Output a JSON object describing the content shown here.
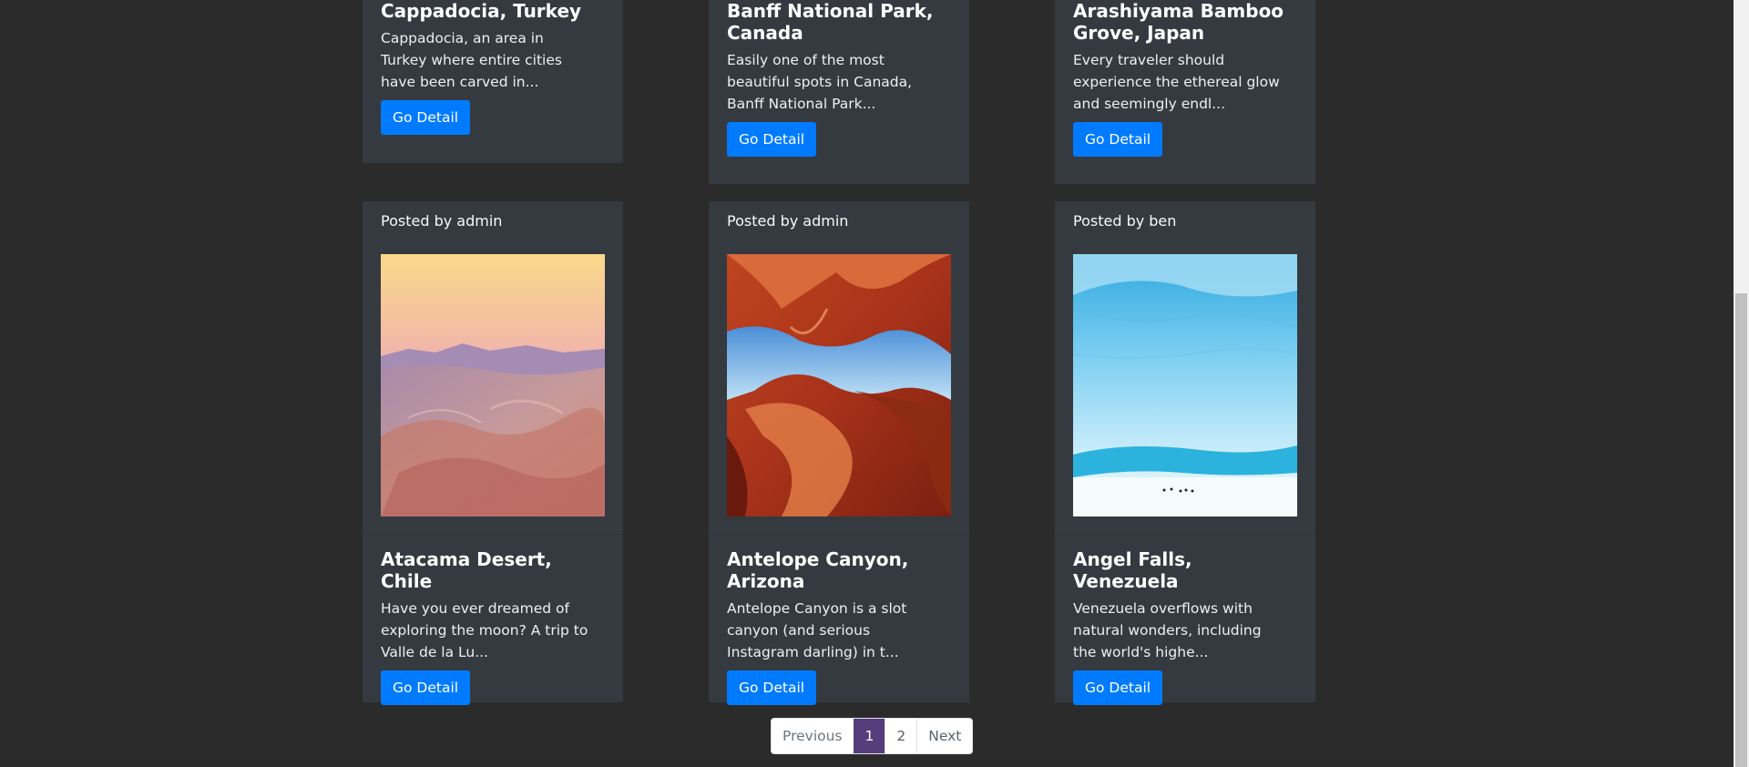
{
  "top_cards": [
    {
      "title": "Cappadocia, Turkey",
      "text": "Cappadocia, an area in Turkey where entire cities have been carved in...",
      "button": "Go Detail"
    },
    {
      "title": "Banff National Park, Canada",
      "text": "Easily one of the most beautiful spots in Canada, Banff National Park...",
      "button": "Go Detail"
    },
    {
      "title": "Arashiyama Bamboo Grove, Japan",
      "text": "Every traveler should experience the ethereal glow and seemingly endl...",
      "button": "Go Detail"
    }
  ],
  "cards": [
    {
      "posted_by": "Posted by admin",
      "image_icon": "desert-landscape-image",
      "title": "Atacama Desert, Chile",
      "text": "Have you ever dreamed of exploring the moon? A trip to Valle de la Lu...",
      "button": "Go Detail"
    },
    {
      "posted_by": "Posted by admin",
      "image_icon": "slot-canyon-image",
      "title": "Antelope Canyon, Arizona",
      "text": "Antelope Canyon is a slot canyon (and serious Instagram darling) in t...",
      "button": "Go Detail"
    },
    {
      "posted_by": "Posted by ben",
      "image_icon": "glacier-image",
      "title": "Angel Falls, Venezuela",
      "text": "Venezuela overflows with natural wonders, including the world's highe...",
      "button": "Go Detail"
    }
  ],
  "pagination": {
    "previous": "Previous",
    "pages": [
      "1",
      "2"
    ],
    "active_page": "1",
    "next": "Next"
  },
  "colors": {
    "background": "#2b2b2b",
    "card": "#343a40",
    "button": "#007bff",
    "active_page": "#563d7c"
  }
}
